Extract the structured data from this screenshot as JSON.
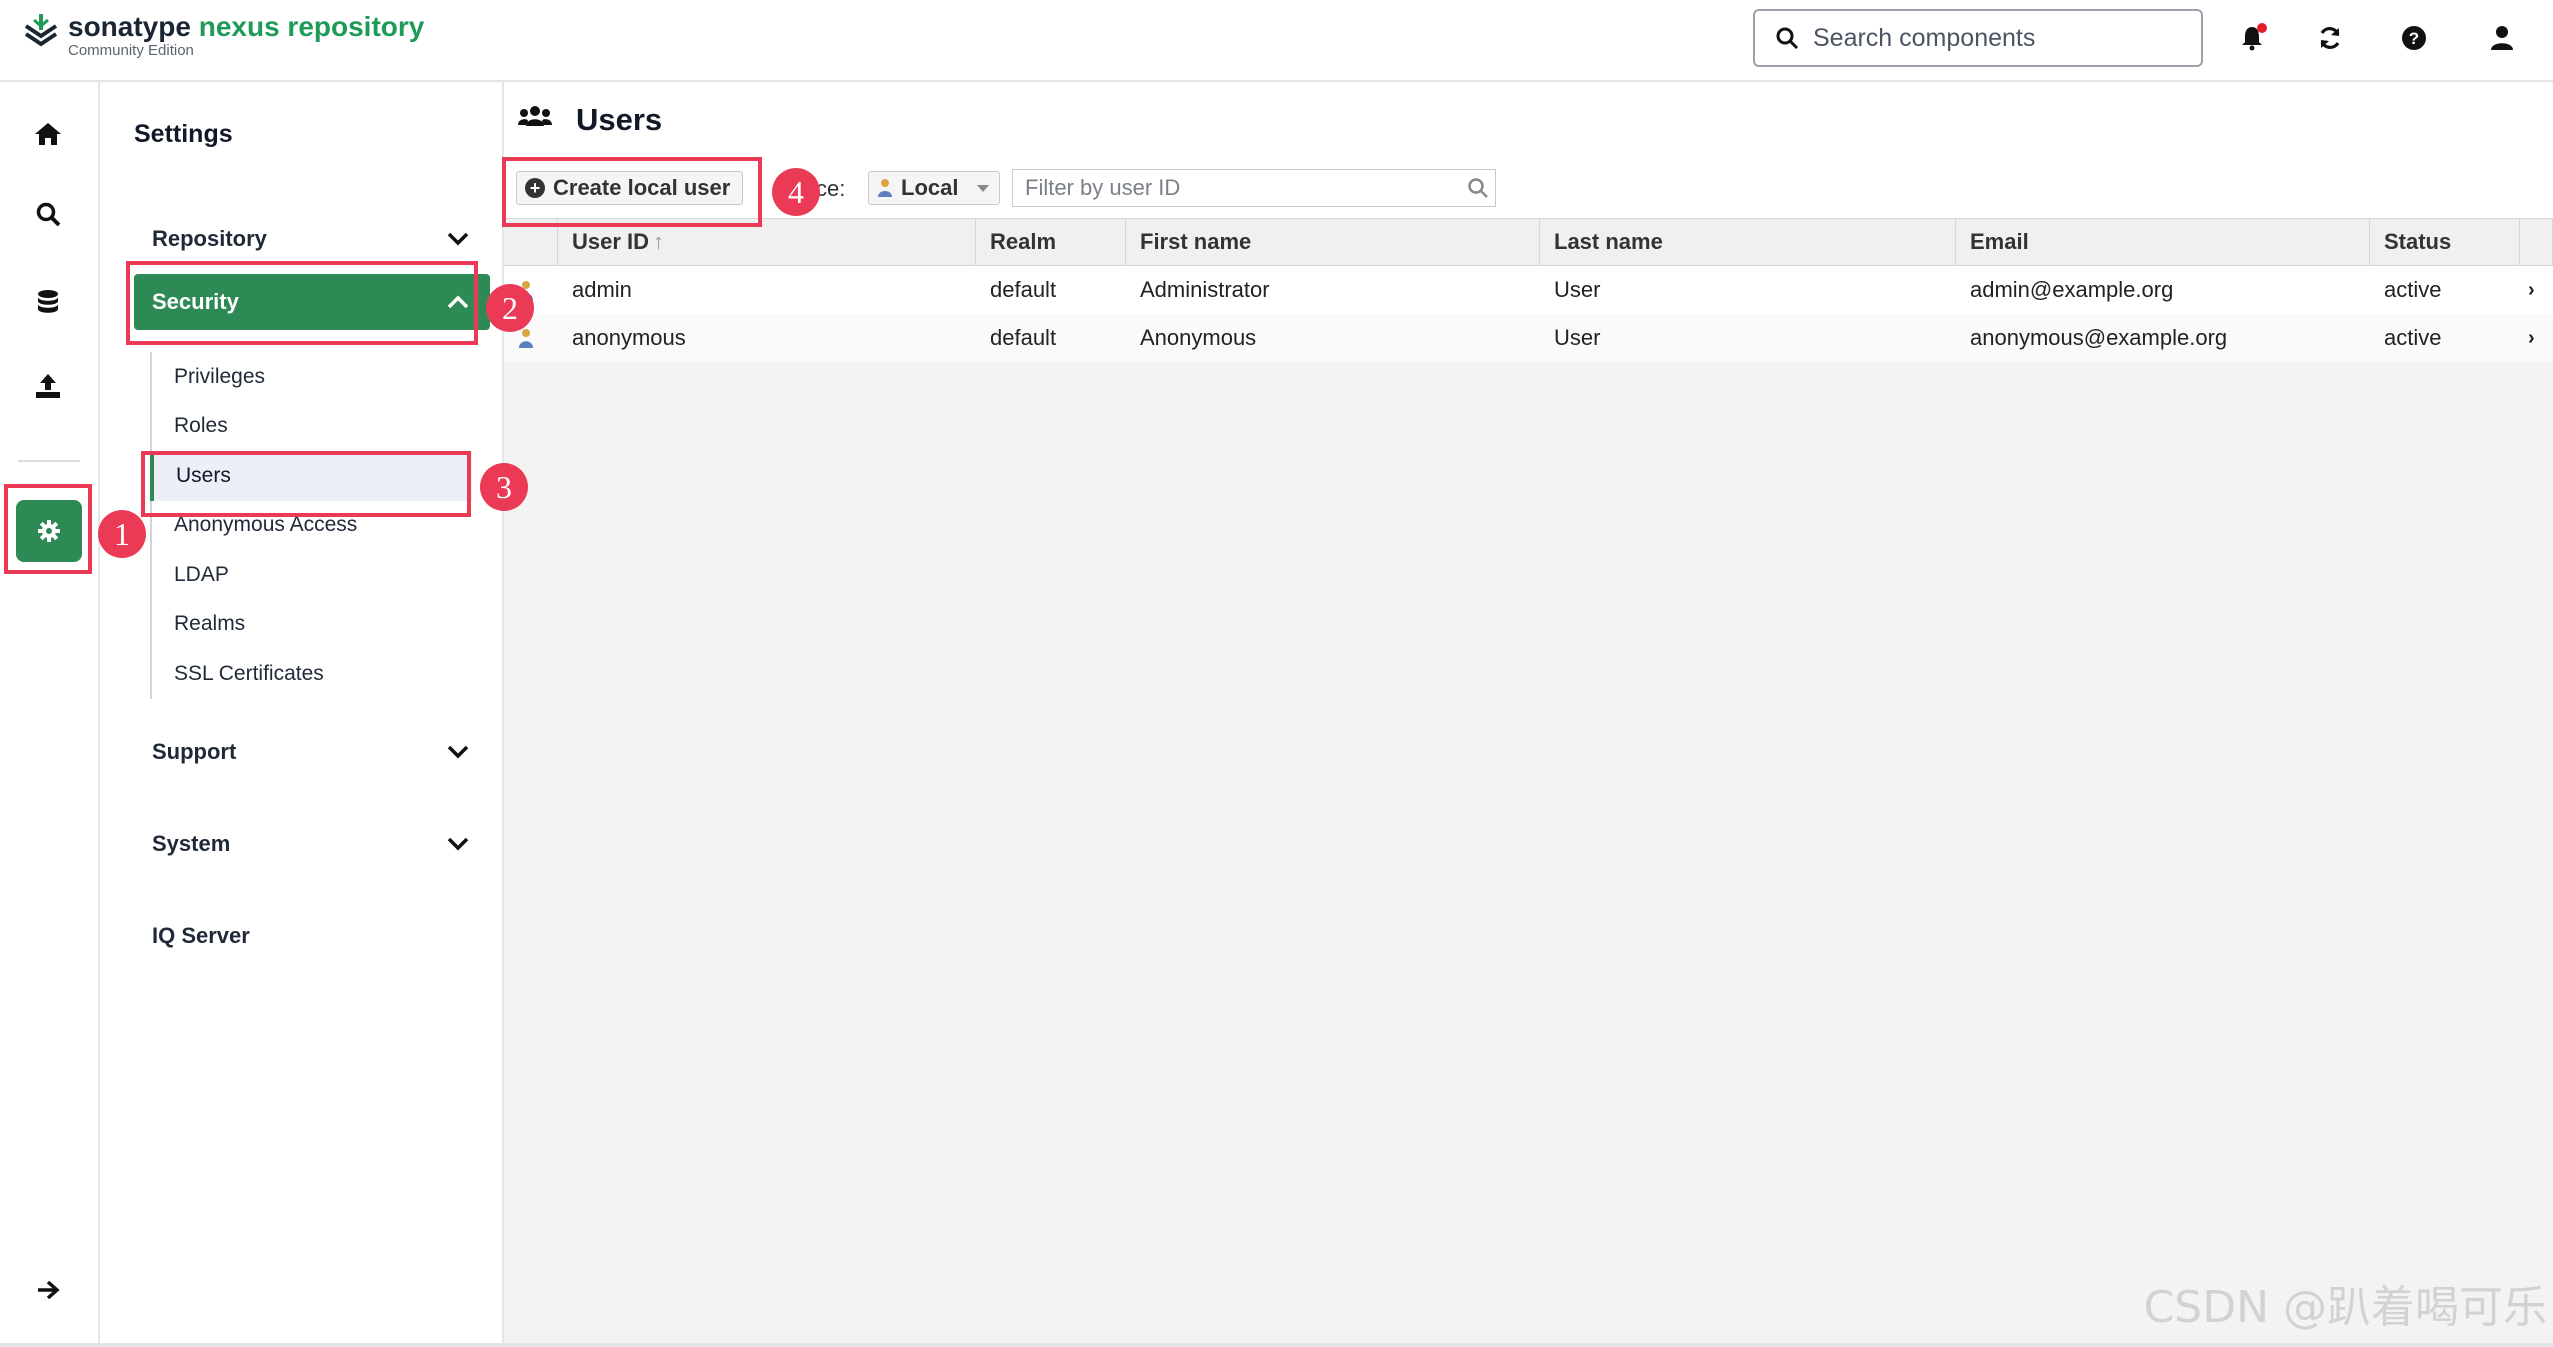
{
  "header": {
    "brand_name": "sonatype",
    "brand_product": "nexus repository",
    "edition": "Community Edition",
    "search_placeholder": "Search components"
  },
  "rail": {
    "icons": [
      "home-icon",
      "search-icon",
      "database-icon",
      "upload-icon",
      "gear-icon",
      "arrow-right-icon"
    ]
  },
  "nav": {
    "title": "Settings",
    "groups": {
      "repository": "Repository",
      "security": "Security",
      "support": "Support",
      "system": "System",
      "iq_server": "IQ Server"
    },
    "security_items": [
      "Privileges",
      "Roles",
      "Users",
      "Anonymous Access",
      "LDAP",
      "Realms",
      "SSL Certificates"
    ]
  },
  "page": {
    "title": "Users",
    "create_button": "Create local user",
    "source_label": "ce:",
    "source_value": "Local",
    "filter_placeholder": "Filter by user ID"
  },
  "table": {
    "columns": [
      "User ID",
      "Realm",
      "First name",
      "Last name",
      "Email",
      "Status"
    ],
    "sort_indicator": "↑",
    "rows": [
      {
        "user_id": "admin",
        "realm": "default",
        "first_name": "Administrator",
        "last_name": "User",
        "email": "admin@example.org",
        "status": "active"
      },
      {
        "user_id": "anonymous",
        "realm": "default",
        "first_name": "Anonymous",
        "last_name": "User",
        "email": "anonymous@example.org",
        "status": "active"
      }
    ]
  },
  "annotations": {
    "badge_1": "1",
    "badge_2": "2",
    "badge_3": "3",
    "badge_4": "4",
    "highlight_color": "#ea3a56"
  },
  "watermark": "CSDN @趴着喝可乐",
  "colors": {
    "brand_green": "#2e8a54",
    "accent": "#1e9b57"
  }
}
